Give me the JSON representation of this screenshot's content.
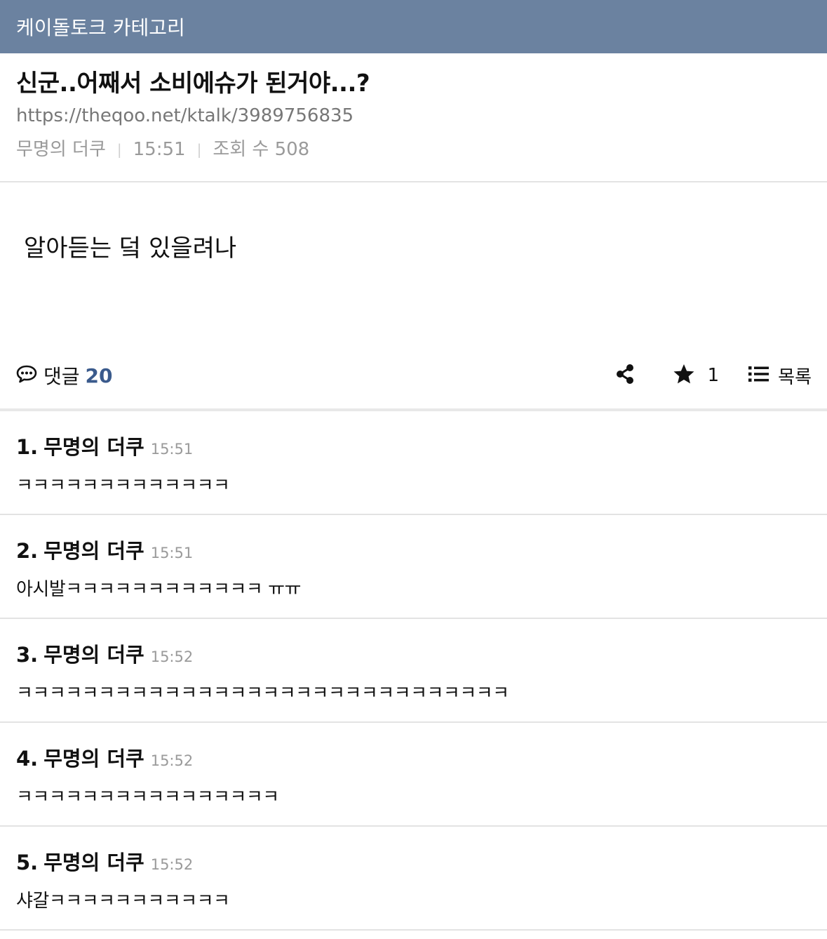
{
  "category_bar": {
    "title": "케이돌토크 카테고리"
  },
  "post": {
    "title": "신군..어째서 소비에슈가 된거야...?",
    "url": "https://theqoo.net/ktalk/3989756835",
    "author": "무명의 더쿠",
    "time": "15:51",
    "views_label": "조회 수 508",
    "body": "알아듣는 덬 있을려나"
  },
  "actions": {
    "comments_label": "댓글",
    "comments_count": "20",
    "star_count": "1",
    "list_label": "목록"
  },
  "icons": {
    "comment": "comment-bubble-icon",
    "share": "share-icon",
    "star": "star-icon",
    "list": "list-icon"
  },
  "colors": {
    "category_bar": "#6b82a0",
    "comment_count": "#3a5a8c",
    "meta_text": "#9a9a9a"
  },
  "comments": [
    {
      "no": "1.",
      "author": "무명의 더쿠",
      "time": "15:51",
      "text": "ㅋㅋㅋㅋㅋㅋㅋㅋㅋㅋㅋㅋㅋ"
    },
    {
      "no": "2.",
      "author": "무명의 더쿠",
      "time": "15:51",
      "text": "아시발ㅋㅋㅋㅋㅋㅋㅋㅋㅋㅋㅋㅋ ㅠㅠ"
    },
    {
      "no": "3.",
      "author": "무명의 더쿠",
      "time": "15:52",
      "text": "ㅋㅋㅋㅋㅋㅋㅋㅋㅋㅋㅋㅋㅋㅋㅋㅋㅋㅋㅋㅋㅋㅋㅋㅋㅋㅋㅋㅋㅋㅋ"
    },
    {
      "no": "4.",
      "author": "무명의 더쿠",
      "time": "15:52",
      "text": "ㅋㅋㅋㅋㅋㅋㅋㅋㅋㅋㅋㅋㅋㅋㅋㅋ"
    },
    {
      "no": "5.",
      "author": "무명의 더쿠",
      "time": "15:52",
      "text": "샤갈ㅋㅋㅋㅋㅋㅋㅋㅋㅋㅋㅋ"
    }
  ]
}
